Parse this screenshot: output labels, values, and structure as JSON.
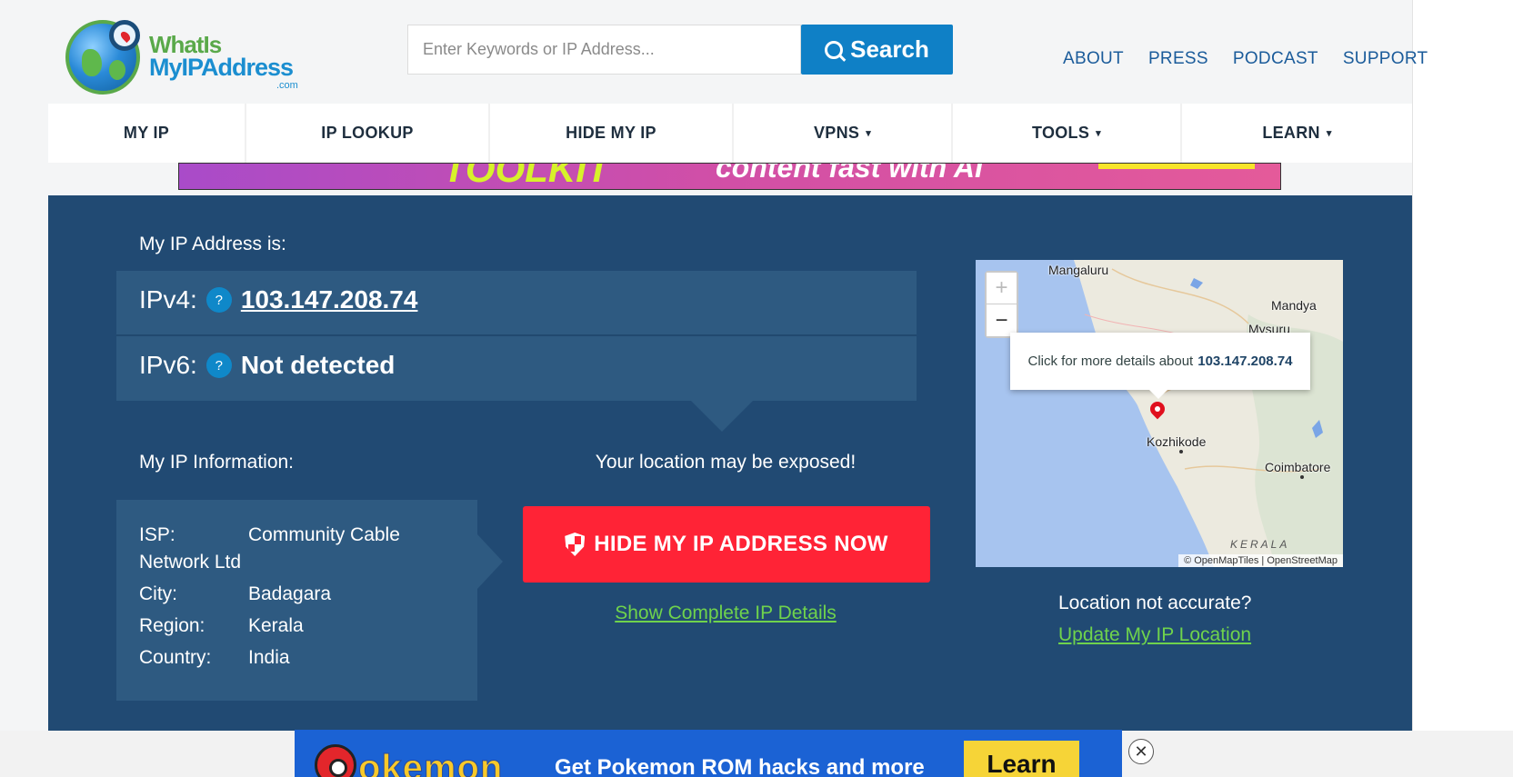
{
  "header": {
    "logo": {
      "line1": "WhatIs",
      "line2": "MyIPAddress",
      "line3": ".com"
    },
    "search": {
      "placeholder": "Enter Keywords or IP Address...",
      "button_label": "Search"
    },
    "links": [
      "ABOUT",
      "PRESS",
      "PODCAST",
      "SUPPORT"
    ]
  },
  "nav": [
    {
      "label": "MY IP",
      "caret": ""
    },
    {
      "label": "IP LOOKUP",
      "caret": ""
    },
    {
      "label": "HIDE MY IP",
      "caret": ""
    },
    {
      "label": "VPNS",
      "caret": "▾"
    },
    {
      "label": "TOOLS",
      "caret": "▾"
    },
    {
      "label": "LEARN",
      "caret": "▾"
    }
  ],
  "ad_top": {
    "text_left": "TOOLKIT",
    "text_mid": "content fast with AI"
  },
  "ip": {
    "heading": "My IP Address is:",
    "ipv4_label": "IPv4:",
    "ipv4_value": "103.147.208.74",
    "ipv6_label": "IPv6:",
    "ipv6_value": "Not detected",
    "help": "?"
  },
  "info": {
    "heading": "My IP Information:",
    "isp_label": "ISP:",
    "isp_value_1": "Community Cable",
    "isp_value_2": "Network Ltd",
    "city_label": "City:",
    "city_value": "Badagara",
    "region_label": "Region:",
    "region_value": "Kerala",
    "country_label": "Country:",
    "country_value": "India"
  },
  "cta": {
    "warning": "Your location may be exposed!",
    "hide_button": "HIDE MY IP ADDRESS NOW",
    "details_link": "Show Complete IP Details"
  },
  "map": {
    "cities": {
      "mangaluru": "Mangaluru",
      "mandya": "Mandya",
      "mysuru": "Mysuru",
      "kozhikode": "Kozhikode",
      "coimbatore": "Coimbatore"
    },
    "region_label": "KERALA",
    "popup_prefix": "Click for more details about",
    "popup_ip": "103.147.208.74",
    "zoom_in": "+",
    "zoom_out": "−",
    "attribution": "© OpenMapTiles | OpenStreetMap",
    "not_accurate": "Location not accurate?",
    "update_link": "Update My IP Location"
  },
  "ad_bottom": {
    "brand": "okemon",
    "message": "Get Pokemon ROM hacks and more",
    "button": "Learn",
    "close": "✕"
  },
  "colors": {
    "panel": "#214a73",
    "panel_box": "#2e5a81",
    "accent_blue": "#0f80c6",
    "cta_red": "#ff2336",
    "link_green": "#6fd34c"
  }
}
